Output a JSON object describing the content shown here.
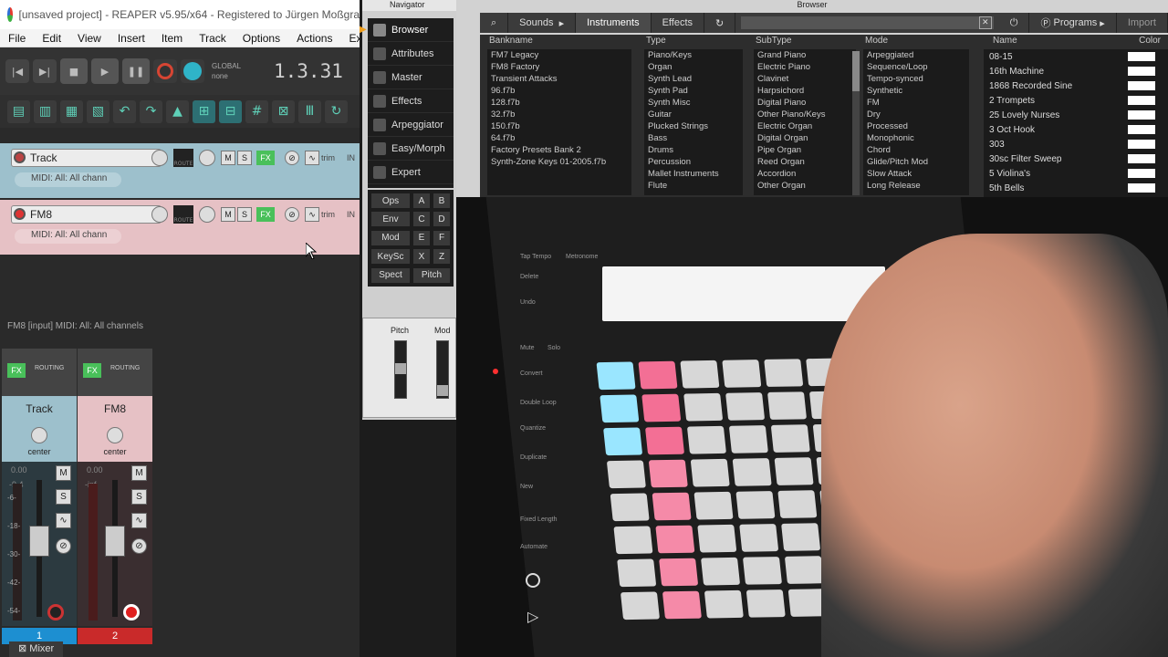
{
  "reaper": {
    "title": "[unsaved project] - REAPER v5.95/x64 - Registered to Jürgen Moßgra",
    "menu": [
      "File",
      "Edit",
      "View",
      "Insert",
      "Item",
      "Track",
      "Options",
      "Actions",
      "Extensio"
    ],
    "transport": {
      "global_label": "GLOBAL",
      "global_value": "none",
      "time": "1.3.31"
    },
    "tracks": [
      {
        "name": "Track",
        "midi": "MIDI: All: All chann",
        "trim": "trim",
        "in": "IN",
        "fx": "FX",
        "route": "ROUTE",
        "m": "M",
        "s": "S"
      },
      {
        "name": "FM8",
        "midi": "MIDI: All: All chann",
        "trim": "trim",
        "in": "IN",
        "fx": "FX",
        "route": "ROUTE",
        "m": "M",
        "s": "S"
      }
    ],
    "input_label": "FM8 [input] MIDI: All: All channels",
    "mixer": [
      {
        "name": "Track",
        "pan": "center",
        "db": "0.00",
        "peak": "-9.4",
        "num": "1",
        "routing": "ROUTING",
        "fx": "FX"
      },
      {
        "name": "FM8",
        "pan": "center",
        "db": "0.00",
        "peak": "-inf",
        "num": "2",
        "routing": "ROUTING",
        "fx": "FX"
      }
    ],
    "scale": [
      "-6-",
      "-18-",
      "-30-",
      "-42-",
      "-54-"
    ],
    "mixer_tab": "Mixer"
  },
  "navigator": {
    "title": "Navigator",
    "items": [
      "Browser",
      "Attributes",
      "Master",
      "Effects",
      "Arpeggiator",
      "Easy/Morph",
      "Expert"
    ],
    "ops": [
      "Ops",
      "A",
      "B",
      "Env",
      "C",
      "D",
      "Mod",
      "E",
      "F",
      "KeySc",
      "X",
      "Z",
      "Spect",
      "Pitch"
    ],
    "pitch": "Pitch",
    "mod": "Mod"
  },
  "browser": {
    "title": "Browser",
    "tabs": {
      "sounds": "Sounds",
      "instruments": "Instruments",
      "effects": "Effects",
      "programs": "Programs",
      "import": "Import"
    },
    "columns": {
      "bankname": {
        "head": "Bankname",
        "items": [
          "FM7 Legacy",
          "FM8 Factory",
          "Transient Attacks",
          "96.f7b",
          "128.f7b",
          "32.f7b",
          "150.f7b",
          "64.f7b",
          "Factory Presets Bank 2",
          "Synth-Zone Keys 01-2005.f7b"
        ]
      },
      "type": {
        "head": "Type",
        "items": [
          "Piano/Keys",
          "Organ",
          "Synth Lead",
          "Synth Pad",
          "Synth Misc",
          "Guitar",
          "Plucked Strings",
          "Bass",
          "Drums",
          "Percussion",
          "Mallet Instruments",
          "Flute"
        ]
      },
      "subtype": {
        "head": "SubType",
        "items": [
          "Grand Piano",
          "Electric Piano",
          "Clavinet",
          "Harpsichord",
          "Digital Piano",
          "Other Piano/Keys",
          "Electric Organ",
          "Digital Organ",
          "Pipe Organ",
          "Reed Organ",
          "Accordion",
          "Other Organ"
        ]
      },
      "mode": {
        "head": "Mode",
        "items": [
          "Arpeggiated",
          "Sequence/Loop",
          "Tempo-synced",
          "Synthetic",
          "FM",
          "Dry",
          "Processed",
          "Monophonic",
          "Chord",
          "Glide/Pitch Mod",
          "Slow Attack",
          "Long Release"
        ]
      }
    },
    "name_head": "Name",
    "color_head": "Color",
    "names": [
      "08-15",
      "16th Machine",
      "1868 Recorded Sine",
      "2 Trompets",
      "25 Lovely Nurses",
      "3 Oct Hook",
      "303",
      "30sc Filter Sweep",
      "5 Violina's",
      "5th Bells"
    ]
  },
  "video": {
    "side_labels": [
      "Delete",
      "Undo",
      "Mute",
      "Solo",
      "Convert",
      "Double Loop",
      "Quantize",
      "Duplicate",
      "New",
      "Fixed Length",
      "Automate"
    ],
    "top_labels": [
      "Tap Tempo",
      "Metronome"
    ]
  }
}
